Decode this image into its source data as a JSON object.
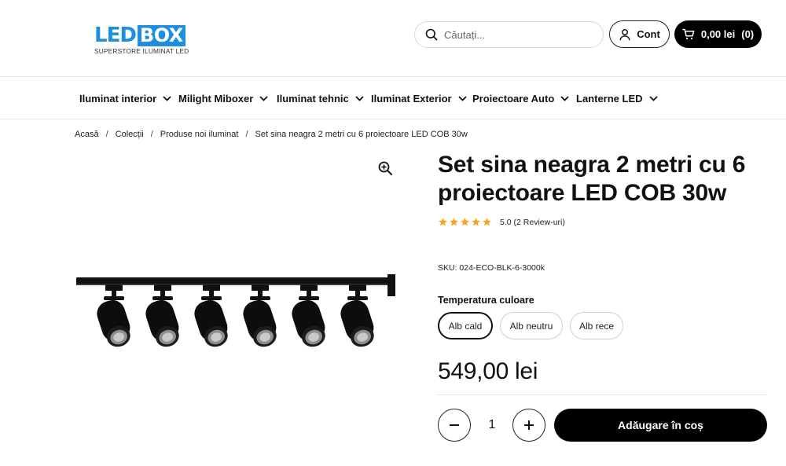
{
  "logo": {
    "brand_part1": "LED",
    "brand_part2": "BOX",
    "tagline": "SUPERSTORE ILUMINAT LED",
    "color": "#1e8fe0"
  },
  "header": {
    "search": {
      "placeholder": "Căutați...",
      "icon": "search-icon"
    },
    "account": {
      "label": "Cont",
      "icon": "user-icon"
    },
    "cart": {
      "total": "0,00 lei",
      "count": "(0)",
      "icon": "cart-icon"
    }
  },
  "nav": {
    "items": [
      {
        "label": "Iluminat interior"
      },
      {
        "label": "Milight Miboxer"
      },
      {
        "label": "Iluminat tehnic"
      },
      {
        "label": "Iluminat Exterior"
      },
      {
        "label": "Proiectoare Auto"
      },
      {
        "label": "Lanterne LED"
      }
    ]
  },
  "breadcrumb": {
    "items": [
      "Acasă",
      "Colecții",
      "Produse noi iluminat",
      "Set sina neagra 2 metri cu 6 proiectoare LED COB 30w"
    ],
    "separator": "/"
  },
  "product": {
    "title": "Set sina neagra 2 metri cu 6 proiectoare LED COB 30w",
    "rating": {
      "stars": 5,
      "text": "5.0 (2 Review-uri)",
      "star_color": "#f5a623"
    },
    "sku": "SKU: 024-ECO-BLK-6-3000k",
    "option_label": "Temperatura culoare",
    "options": [
      {
        "label": "Alb cald",
        "selected": true
      },
      {
        "label": "Alb neutru",
        "selected": false
      },
      {
        "label": "Alb rece",
        "selected": false
      }
    ],
    "price": "549,00 lei",
    "quantity": "1",
    "add_to_cart": "Adăugare în coș",
    "zoom_icon": "zoom-in-icon",
    "spotlight_count": 6
  },
  "colors": {
    "primary_button": "#000000",
    "text": "#111111",
    "border": "#d9d9d9"
  }
}
